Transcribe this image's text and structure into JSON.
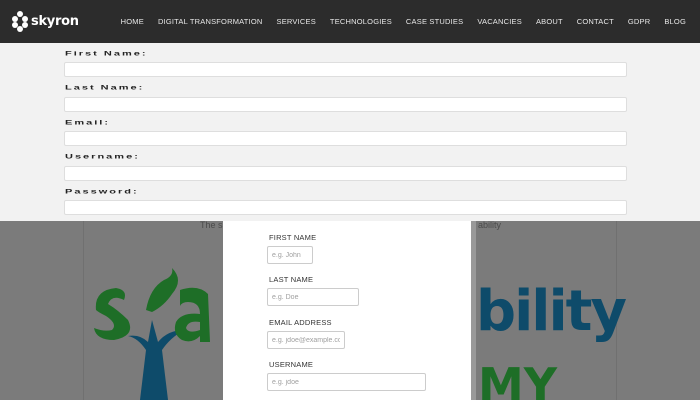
{
  "brand": {
    "name": "skyron"
  },
  "nav": {
    "items": [
      "HOME",
      "DIGITAL TRANSFORMATION",
      "SERVICES",
      "TECHNOLOGIES",
      "CASE STUDIES",
      "VACANCIES",
      "ABOUT",
      "CONTACT",
      "GDPR",
      "BLOG"
    ]
  },
  "big_form": {
    "first_name_label": "First Name:",
    "last_name_label": "Last Name:",
    "email_label": "Email:",
    "username_label": "Username:",
    "password_label": "Password:"
  },
  "background": {
    "tagline_left": "The s",
    "tagline_right": "ability",
    "logo_right_text": "bility",
    "logo_right_sub": "MY"
  },
  "modal": {
    "first_name_label": "FIRST NAME",
    "first_name_placeholder": "e.g. John",
    "last_name_label": "LAST NAME",
    "last_name_placeholder": "e.g. Doe",
    "email_label": "EMAIL ADDRESS",
    "email_placeholder": "e.g. jdoe@example.com",
    "username_label": "USERNAME",
    "username_placeholder": "e.g. jdoe"
  },
  "colors": {
    "topbar": "#2c2c2c",
    "overlay": "#7b7b7b",
    "logo_blue": "#0e4b6a",
    "logo_green": "#1e6e27"
  }
}
